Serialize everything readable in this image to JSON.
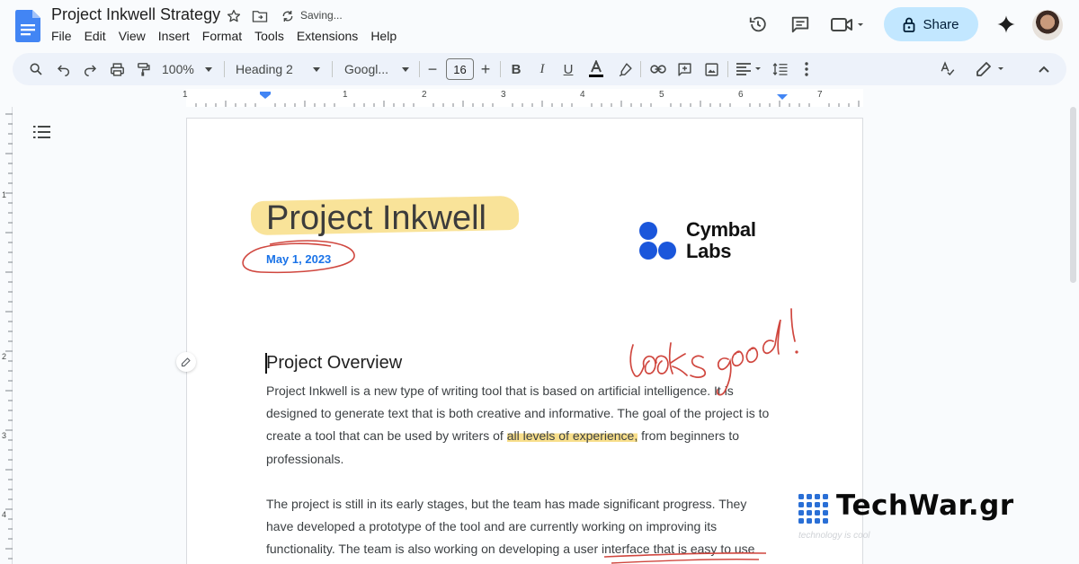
{
  "window": {
    "doc_title": "Project Inkwell Strategy",
    "save_status": "Saving..."
  },
  "menu": [
    "File",
    "Edit",
    "View",
    "Insert",
    "Format",
    "Tools",
    "Extensions",
    "Help"
  ],
  "header": {
    "share_label": "Share",
    "icons": [
      "history-icon",
      "comment-icon",
      "meet-icon",
      "lock-icon",
      "gemini-icon"
    ]
  },
  "toolbar": {
    "zoom": "100%",
    "style": "Heading 2",
    "font": "Googl...",
    "font_size": "16"
  },
  "ruler": {
    "numbers": [
      "1",
      "1",
      "2",
      "3",
      "4",
      "5",
      "6",
      "7"
    ]
  },
  "vertical_ruler": {
    "numbers": [
      "1",
      "2",
      "3",
      "4"
    ]
  },
  "document": {
    "title": "Project Inkwell",
    "date": "May 1, 2023",
    "logo_text_line1": "Cymbal",
    "logo_text_line2": "Labs",
    "handwritten_note": "looks good!",
    "section_heading": "Project Overview",
    "para1_before": "Project Inkwell is a new type of writing tool that is based on artificial intelligence. It is designed to generate text that is both creative and informative. The goal of the project is to create a tool that can be used by writers of ",
    "para1_highlight": "all levels of experience,",
    "para1_after": " from beginners to professionals.",
    "para2_before": "The project is still in its early stages, but the team has made significant progress. They have developed a prototype of the tool and are currently working on improving its functionality. The team is also working on developing a user interface that is ",
    "para2_underline": "easy to use and navigate."
  },
  "watermark": {
    "brand": "TechWar.gr",
    "tagline": "technology is cool"
  },
  "colors": {
    "accent": "#1a73e8",
    "share_bg": "#c2e7ff",
    "highlight": "#f7d977",
    "annotation_red": "#d0473f"
  }
}
